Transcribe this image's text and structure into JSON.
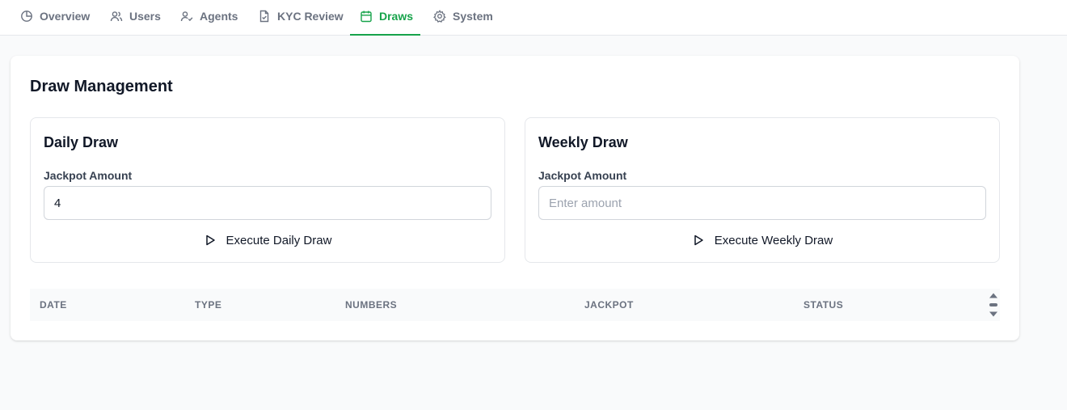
{
  "nav": {
    "tabs": [
      {
        "label": "Overview",
        "icon": "pie-chart-icon"
      },
      {
        "label": "Users",
        "icon": "users-icon"
      },
      {
        "label": "Agents",
        "icon": "user-check-icon"
      },
      {
        "label": "KYC Review",
        "icon": "file-check-icon"
      },
      {
        "label": "Draws",
        "icon": "calendar-icon",
        "active": true
      },
      {
        "label": "System",
        "icon": "gear-icon"
      }
    ],
    "active_color": "#16a34a"
  },
  "main": {
    "title": "Draw Management",
    "daily": {
      "title": "Daily Draw",
      "label": "Jackpot Amount",
      "value": "4",
      "placeholder": "Enter amount",
      "button": "Execute Daily Draw",
      "button_icon": "play-icon"
    },
    "weekly": {
      "title": "Weekly Draw",
      "label": "Jackpot Amount",
      "value": "",
      "placeholder": "Enter amount",
      "button": "Execute Weekly Draw",
      "button_icon": "play-icon"
    },
    "table": {
      "columns": [
        "DATE",
        "TYPE",
        "NUMBERS",
        "JACKPOT",
        "STATUS"
      ],
      "rows": []
    }
  }
}
